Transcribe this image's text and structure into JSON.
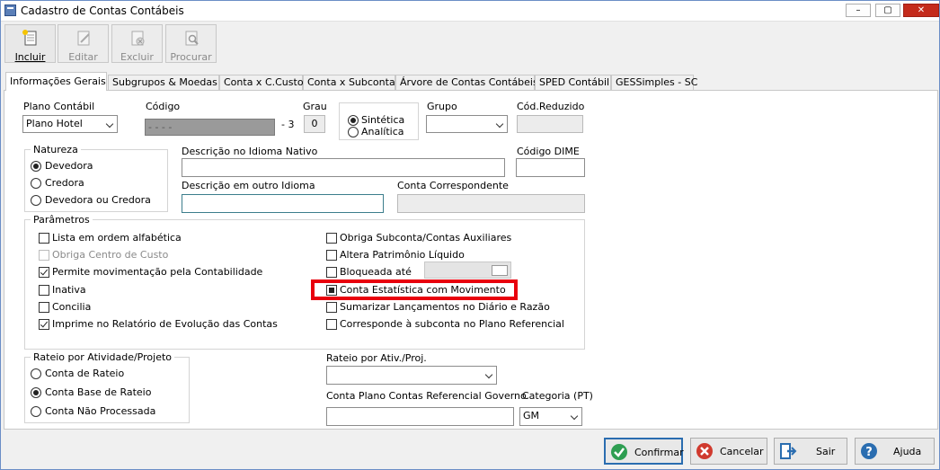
{
  "window": {
    "title": "Cadastro de Contas Contábeis",
    "minimize": "–",
    "restore": "▢",
    "close": "✕"
  },
  "toolbar": [
    {
      "label": "Incluir",
      "icon": "new-document-icon",
      "enabled": true
    },
    {
      "label": "Editar",
      "icon": "edit-document-icon",
      "enabled": false
    },
    {
      "label": "Excluir",
      "icon": "delete-document-icon",
      "enabled": false
    },
    {
      "label": "Procurar",
      "icon": "search-document-icon",
      "enabled": false
    }
  ],
  "tabs": [
    "Informações Gerais",
    "Subgrupos & Moedas",
    "Conta x C.Custo",
    "Conta x Subconta",
    "Árvore de Contas Contábeis",
    "SPED Contábil",
    "GESSimples - SC"
  ],
  "form": {
    "plano_label": "Plano Contábil",
    "plano_value": "Plano Hotel",
    "codigo_label": "Código",
    "codigo_value": "  -  -  -  -",
    "codigo_suffix": "- 3",
    "grau_label": "Grau",
    "grau_value": "0",
    "tipo_sintetica": "Sintética",
    "tipo_analitica": "Analítica",
    "grupo_label": "Grupo",
    "grupo_value": "",
    "codreduzido_label": "Cód.Reduzido",
    "codreduzido_value": "",
    "natureza_legend": "Natureza",
    "natureza_devedora": "Devedora",
    "natureza_credora": "Credora",
    "natureza_ambas": "Devedora ou Credora",
    "desc_nativo_label": "Descrição no Idioma Nativo",
    "desc_nativo_value": "",
    "dime_label": "Código DIME",
    "dime_value": "",
    "desc_outro_label": "Descrição em outro Idioma",
    "desc_outro_value": "",
    "correspondente_label": "Conta Correspondente",
    "correspondente_value": "",
    "parametros_legend": "Parâmetros",
    "params_left": [
      {
        "label": "Lista em ordem alfabética",
        "checked": false,
        "disabled": false
      },
      {
        "label": "Obriga Centro de Custo",
        "checked": false,
        "disabled": true
      },
      {
        "label": "Permite movimentação pela Contabilidade",
        "checked": true,
        "disabled": false
      },
      {
        "label": "Inativa",
        "checked": false,
        "disabled": false
      },
      {
        "label": "Concilia",
        "checked": false,
        "disabled": false
      },
      {
        "label": "Imprime no Relatório de Evolução das Contas",
        "checked": true,
        "disabled": false
      }
    ],
    "params_right": [
      {
        "label": "Obriga Subconta/Contas Auxiliares",
        "checked": false
      },
      {
        "label": "Altera Patrimônio Líquido",
        "checked": false
      },
      {
        "label": "Bloqueada até",
        "checked": false
      },
      {
        "label": "Conta Estatística com Movimento",
        "checked": true
      },
      {
        "label": "Sumarizar Lançamentos no Diário e Razão",
        "checked": false
      },
      {
        "label": "Corresponde à subconta no Plano Referencial",
        "checked": false
      }
    ],
    "rateio_legend": "Rateio por Atividade/Projeto",
    "rateio_conta": "Conta de Rateio",
    "rateio_base": "Conta Base de Rateio",
    "rateio_nao": "Conta Não Processada",
    "rateio_ativ_label": "Rateio por Ativ./Proj.",
    "rateio_ativ_value": "",
    "ref_gov_label": "Conta Plano Contas Referencial Governo",
    "ref_gov_value": "",
    "categoria_label": "Categoria (PT)",
    "categoria_value": "GM"
  },
  "buttons": {
    "confirmar": "Confirmar",
    "cancelar": "Cancelar",
    "sair": "Sair",
    "ajuda": "Ajuda"
  },
  "colors": {
    "highlight": "#e8000d",
    "confirm": "#2e9e52",
    "cancel": "#d03a2e",
    "exit": "#2a6db0",
    "help": "#2a6db0"
  }
}
